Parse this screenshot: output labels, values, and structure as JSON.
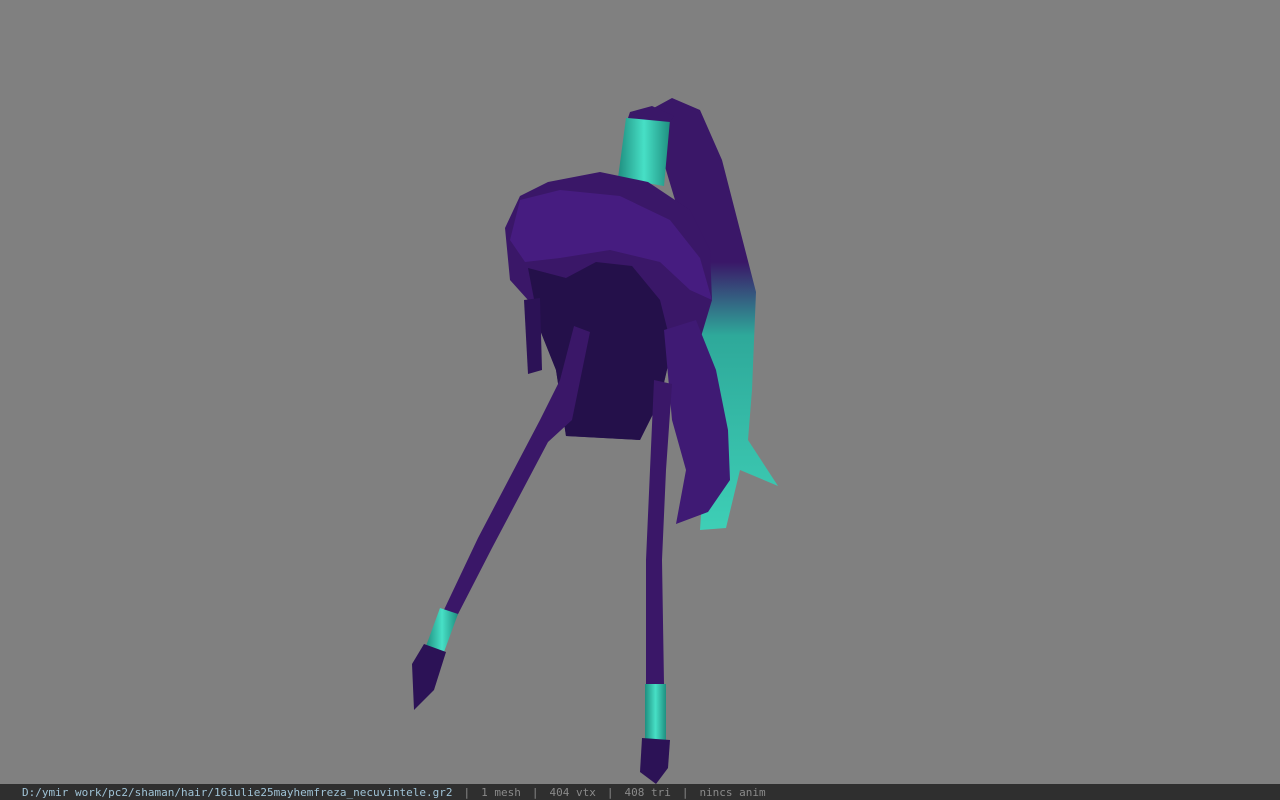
{
  "viewport": {
    "background": "#808080",
    "model_colors": {
      "hair": "#3a1768",
      "hair_dark": "#24104a",
      "hair_mid": "#4a1e86",
      "accent": "#3ecfb6"
    }
  },
  "statusbar": {
    "file_path": "D:/ymir work/pc2/shaman/hair/16iulie25mayhemfreza_necuvintele.gr2",
    "separator": "|",
    "mesh": "1 mesh",
    "vertices": "404 vtx",
    "triangles": "408 tri",
    "anim": "nincs anim"
  }
}
